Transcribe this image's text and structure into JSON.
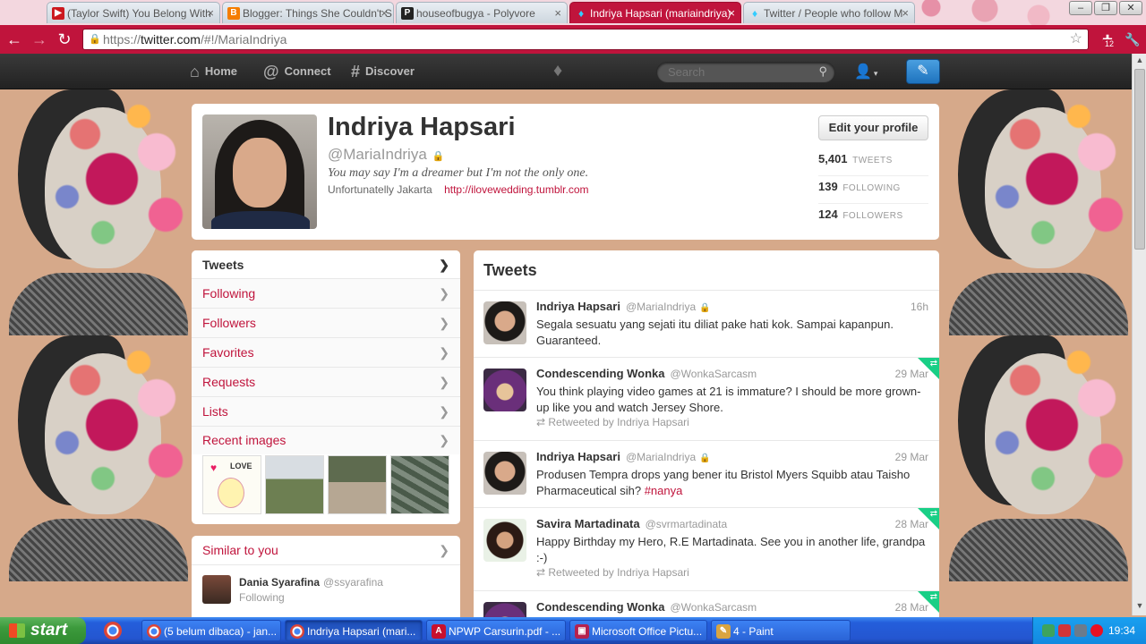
{
  "browser": {
    "tabs": [
      {
        "title": "(Taylor Swift) You Belong With",
        "icon": "youtube-icon"
      },
      {
        "title": "Blogger: Things She Couldn't S",
        "icon": "blogger-icon"
      },
      {
        "title": "houseofbugya - Polyvore",
        "icon": "polyvore-icon"
      },
      {
        "title": "Indriya Hapsari (mariaindriya)",
        "icon": "twitter-icon"
      },
      {
        "title": "Twitter / People who follow M",
        "icon": "twitter-icon"
      }
    ],
    "url_prefix": "https://",
    "url_host": "twitter.com",
    "url_path": "/#!/MariaIndriya",
    "extension_badge": "12"
  },
  "topbar": {
    "home": "Home",
    "connect": "Connect",
    "discover": "Discover",
    "search_placeholder": "Search"
  },
  "profile": {
    "name": "Indriya Hapsari",
    "handle": "@MariaIndriya",
    "bio": "You may say I'm a dreamer but I'm not the only one.",
    "location": "Unfortunatelly Jakarta",
    "link": "http://ilovewedding.tumblr.com",
    "edit_button": "Edit your profile",
    "stats": [
      {
        "num": "5,401",
        "label": "TWEETS"
      },
      {
        "num": "139",
        "label": "FOLLOWING"
      },
      {
        "num": "124",
        "label": "FOLLOWERS"
      }
    ]
  },
  "leftnav": {
    "items": [
      "Tweets",
      "Following",
      "Followers",
      "Favorites",
      "Requests",
      "Lists",
      "Recent images"
    ],
    "thumb1_text": "LOVE"
  },
  "similar": {
    "title": "Similar to you",
    "user_name": "Dania Syarafina",
    "user_handle": "@ssyarafina",
    "user_status": "Following"
  },
  "stream": {
    "title": "Tweets",
    "tweets": [
      {
        "name": "Indriya Hapsari",
        "handle": "@MariaIndriya",
        "time": "16h",
        "text": "Segala sesuatu yang sejati itu diliat pake hati kok. Sampai kapanpun. Guaranteed.",
        "retweet": ""
      },
      {
        "name": "Condescending Wonka",
        "handle": "@WonkaSarcasm",
        "time": "29 Mar",
        "text": "You think playing video games at 21 is immature? I should be more grown-up like you and watch Jersey Shore.",
        "retweet": "Retweeted by Indriya Hapsari"
      },
      {
        "name": "Indriya Hapsari",
        "handle": "@MariaIndriya",
        "time": "29 Mar",
        "text": "Produsen Tempra drops yang bener itu Bristol Myers Squibb atau Taisho Pharmaceutical sih?",
        "hashtag": "#nanya",
        "retweet": ""
      },
      {
        "name": "Savira Martadinata",
        "handle": "@svrmartadinata",
        "time": "28 Mar",
        "text": "Happy Birthday my Hero, R.E Martadinata. See you in another life, grandpa :-)",
        "retweet": "Retweeted by Indriya Hapsari"
      },
      {
        "name": "Condescending Wonka",
        "handle": "@WonkaSarcasm",
        "time": "28 Mar",
        "text": "",
        "retweet": ""
      }
    ]
  },
  "taskbar": {
    "start": "start",
    "tasks": [
      "(5 belum dibaca) - jan...",
      "Indriya Hapsari (mari...",
      "NPWP Carsurin.pdf - ...",
      "Microsoft Office Pictu...",
      "4 - Paint"
    ],
    "clock": "19:34"
  }
}
